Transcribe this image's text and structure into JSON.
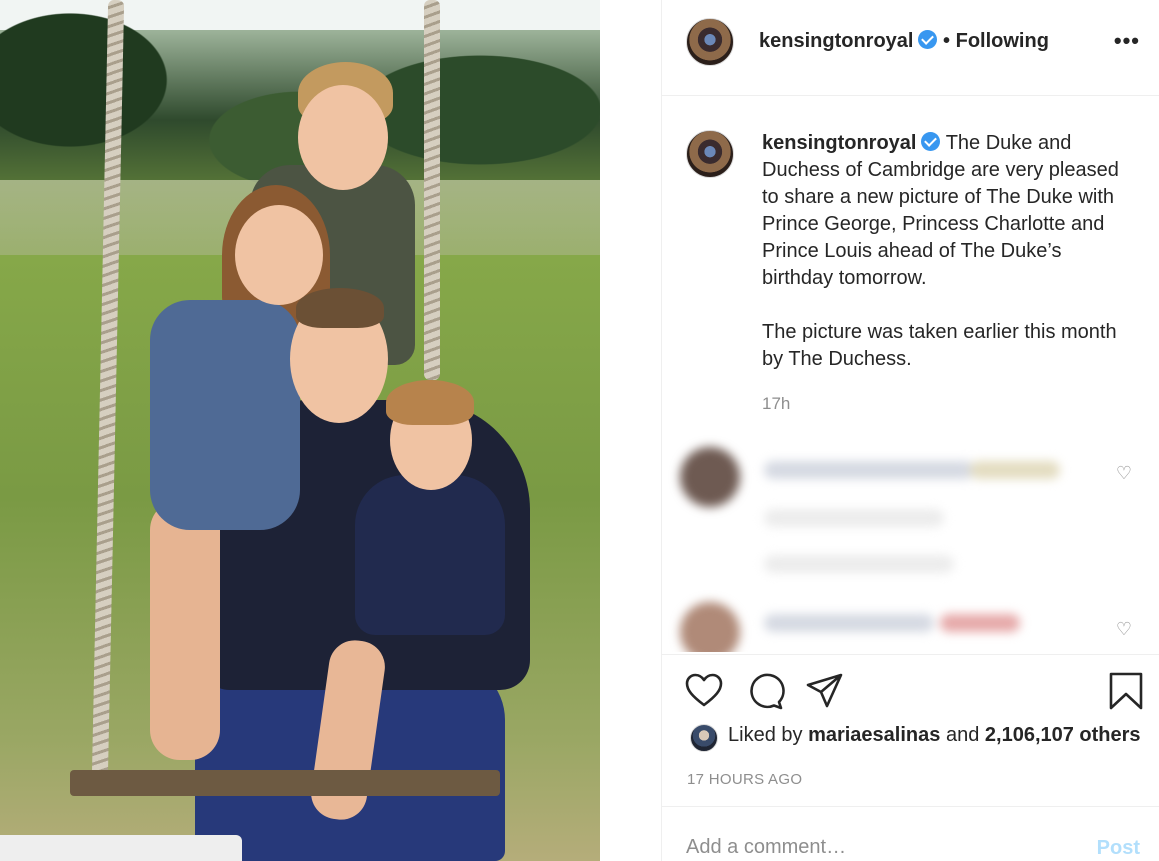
{
  "post": {
    "account": "kensingtonroyal",
    "follow_status": "• Following",
    "more_options": "•••"
  },
  "caption": {
    "username": "kensingtonroyal",
    "paragraph1": "The Duke and Duchess of Cambridge are very pleased to share a new picture of The Duke with Prince George, Princess Charlotte and Prince Louis ahead of The Duke’s birthday tomorrow.",
    "paragraph2": "The picture was taken earlier this month by The Duchess.",
    "time_ago": "17h"
  },
  "likes": {
    "prefix": "Liked by",
    "liker": "maria​esalinas",
    "connector": "and",
    "others": "2,106,107 others"
  },
  "timestamp": "17 HOURS AGO",
  "comment": {
    "placeholder": "Add a comment…",
    "post_label": "Post"
  },
  "icons": {
    "like": "heart-icon",
    "comment": "comment-icon",
    "share": "paper-plane-icon",
    "save": "bookmark-icon",
    "verified": "verified-badge-icon"
  },
  "colors": {
    "verified": "#3897f0",
    "post_disabled": "#b2dffc",
    "secondary_text": "#8e8e8e",
    "border": "#efefef"
  }
}
